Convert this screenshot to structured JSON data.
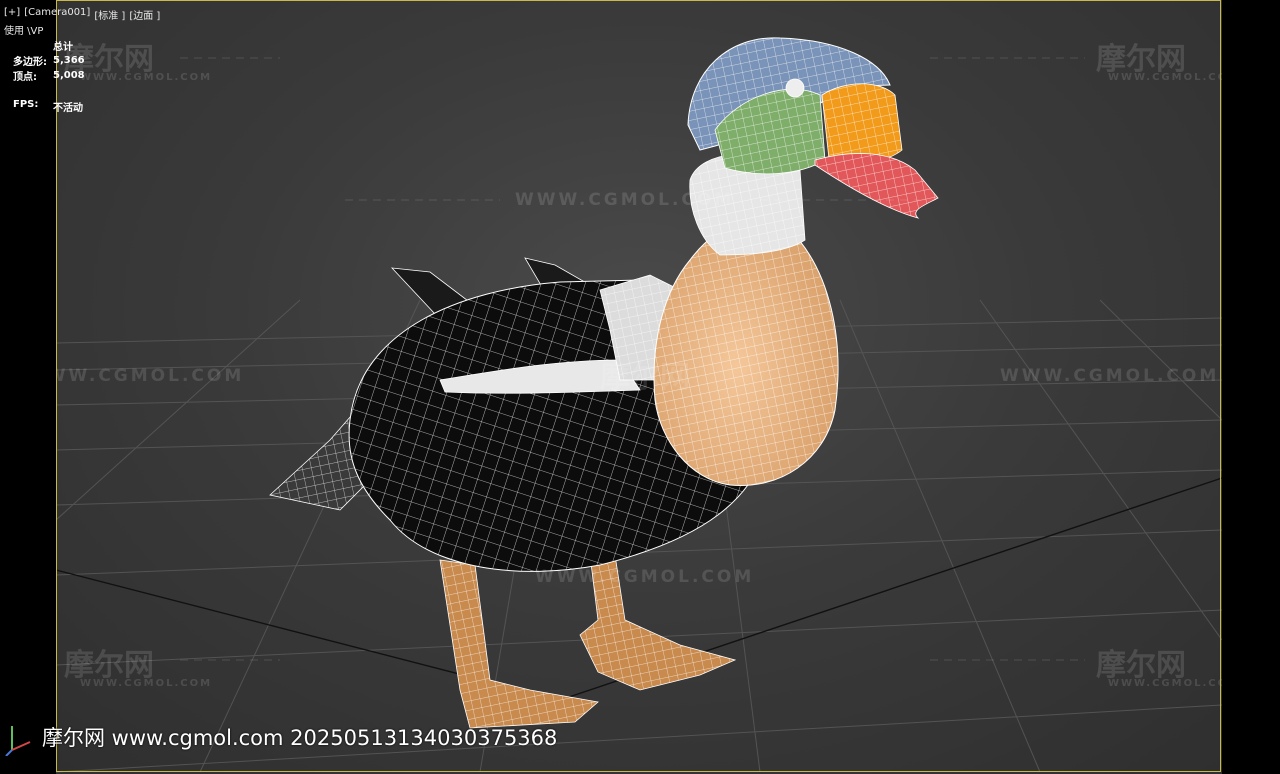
{
  "viewport": {
    "labels": [
      "[+]",
      "[Camera001]",
      "[标准 ]",
      "[边面 ]"
    ],
    "sub_label": "使用 \\VP",
    "stats": {
      "header": "总计",
      "polygons_label": "多边形:",
      "polygons_value": "5,366",
      "vertices_label": "顶点:",
      "vertices_value": "5,008"
    },
    "fps": {
      "label": "FPS:",
      "value": "不活动"
    }
  },
  "watermarks": {
    "logo": "摩尔网",
    "sub": "WWW.CGMOL.COM",
    "url": "WWW.CGMOL.COM"
  },
  "footer": {
    "text": "摩尔网 www.cgmol.com 20250513134030375368"
  },
  "colors": {
    "frame": "#c9b94a",
    "grid": "#5a5a5a",
    "wire": "#ffffff",
    "head_blue": "#7a93b8",
    "cheek_green": "#7fae6b",
    "face_orange": "#f29a1a",
    "beak_red": "#e2585a",
    "breast_tan": "#e9b98a",
    "body_black": "#0c0c0c",
    "legs": "#c98a4e"
  }
}
